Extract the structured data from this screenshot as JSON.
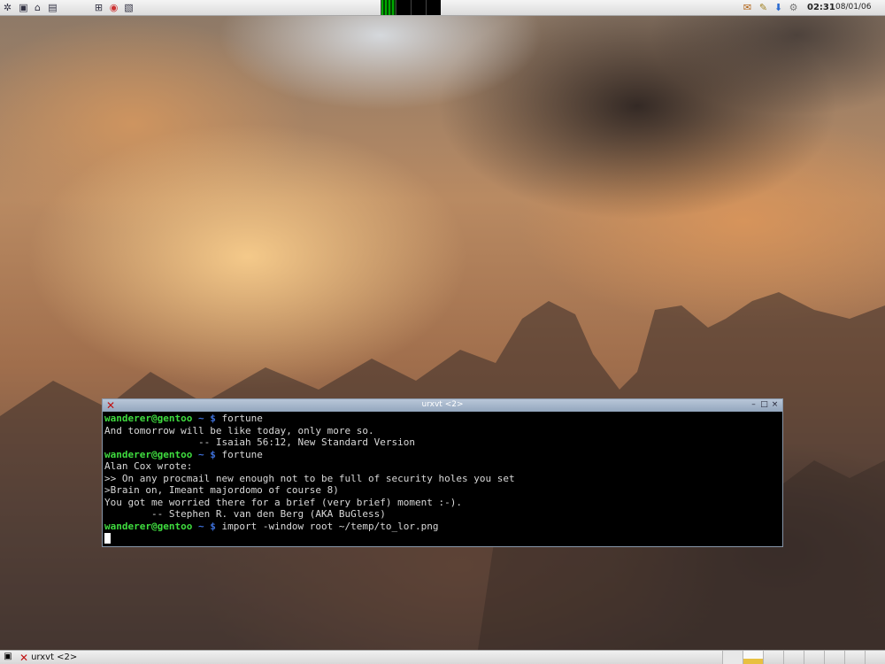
{
  "top_panel": {
    "launchers": [
      "app-menu-icon",
      "terminal-icon",
      "home-icon",
      "show-desktop-icon",
      "network-icon",
      "opera-icon",
      "image-viewer-icon"
    ],
    "workspaces_active": 1,
    "tray_icons": [
      "mail-icon",
      "pencil-icon",
      "arrow-down-icon",
      "settings-icon"
    ],
    "clock": "02:31",
    "date": "08/01/06"
  },
  "terminal": {
    "title": "urxvt <2>",
    "prompt": {
      "user": "wanderer@gentoo",
      "dir": " ~ $"
    },
    "lines": [
      {
        "type": "cmd",
        "text": " fortune"
      },
      {
        "type": "out",
        "text": "And tomorrow will be like today, only more so."
      },
      {
        "type": "out",
        "text": "                -- Isaiah 56:12, New Standard Version"
      },
      {
        "type": "cmd",
        "text": " fortune"
      },
      {
        "type": "out",
        "text": "Alan Cox wrote:"
      },
      {
        "type": "out",
        "text": ">> On any procmail new enough not to be full of security holes you set"
      },
      {
        "type": "out",
        "text": ">Brain on, Imeant majordomo of course 8)"
      },
      {
        "type": "out",
        "text": "You got me worried there for a brief (very brief) moment :-)."
      },
      {
        "type": "out",
        "text": "        -- Stephen R. van den Berg (AKA BuGless)"
      },
      {
        "type": "cmd",
        "text": " import -window root ~/temp/to_lor.png"
      }
    ]
  },
  "taskbar": {
    "task_label": "urxvt <2>"
  },
  "colors": {
    "prompt_user": "#3fdc3f",
    "prompt_dir": "#3d6fd8",
    "terminal_bg": "#000000",
    "terminal_fg": "#d8d8d8"
  }
}
